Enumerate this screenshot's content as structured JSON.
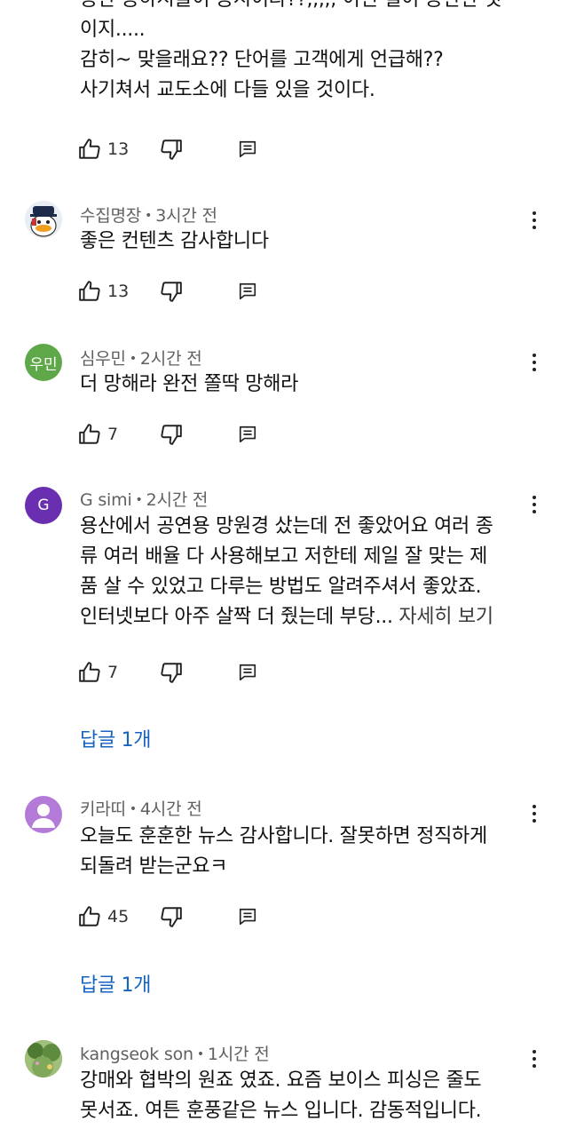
{
  "comments": [
    {
      "author": "",
      "time": "",
      "text_lines": [
        "공간 공하시들이 공시이라??,,,,, 이런 일이 공란란 것",
        "이지.....",
        "감히~ 맞을래요?? 단어를 고객에게 언급해??",
        "사기쳐서 교도소에 다들 있을 것이다."
      ],
      "likes": "13"
    },
    {
      "author": "수집명장",
      "time": "3시간 전",
      "avatar_icon": "duck-character-avatar",
      "text_lines": [
        "좋은 컨텐츠 감사합니다"
      ],
      "likes": "13"
    },
    {
      "author": "심우민",
      "time": "2시간 전",
      "avatar_text": "우민",
      "avatar_color": "#5fa84a",
      "text_lines": [
        "더 망해라 완전 쫄딱 망해라"
      ],
      "likes": "7"
    },
    {
      "author": "G simi",
      "time": "2시간 전",
      "avatar_text": "G",
      "avatar_color": "#6a2fb0",
      "text_lines": [
        "용산에서 공연용 망원경 샀는데 전 좋았어요 여러 종",
        "류 여러 배율 다 사용해보고 저한테 제일 잘 맞는 제",
        "품 살 수 있었고 다루는 방법도 알려주셔서 좋았죠.",
        "인터넷보다 아주 살짝 더 줬는데 부당..."
      ],
      "see_more": "자세히 보기",
      "likes": "7",
      "replies": "답글 1개"
    },
    {
      "author": "키라띠",
      "time": "4시간 전",
      "avatar_icon": "default-person-avatar",
      "avatar_color": "#b47ad8",
      "text_lines": [
        "오늘도 훈훈한 뉴스 감사합니다. 잘못하면 정직하게",
        "되돌려 받는군요ㅋ"
      ],
      "likes": "45",
      "replies": "답글 1개"
    },
    {
      "author": "kangseok son",
      "time": "1시간 전",
      "avatar_icon": "landscape-photo-avatar",
      "text_lines": [
        "강매와 협박의 원죠 였죠. 요즘 보이스 피싱은 줄도",
        "못서죠. 여튼 훈풍같은 뉴스 입니다. 감동적입니다."
      ]
    }
  ],
  "colors": {
    "link": "#1565c0",
    "meta": "#606060"
  }
}
